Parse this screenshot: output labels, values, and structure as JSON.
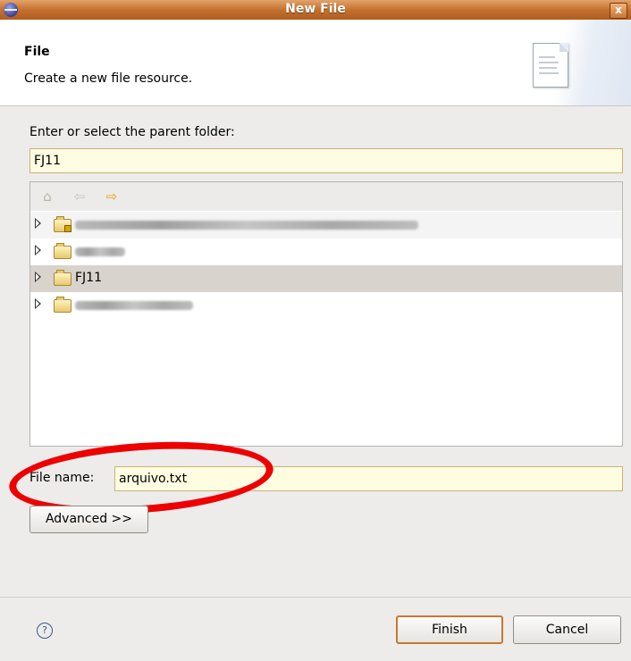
{
  "window": {
    "title": "New File",
    "close_label": "x"
  },
  "header": {
    "title": "File",
    "description": "Create a new file resource."
  },
  "parent_folder": {
    "label": "Enter or select the parent folder:",
    "value": "FJ11"
  },
  "tree": {
    "toolbar_icons": [
      "home-icon",
      "back-arrow-icon",
      "forward-arrow-icon"
    ],
    "items": [
      {
        "label": "",
        "icon": "project-folder-icon",
        "expanded": false
      },
      {
        "label": "",
        "icon": "folder-icon",
        "expanded": false
      },
      {
        "label": "FJ11",
        "icon": "folder-icon",
        "expanded": false,
        "selected": true
      },
      {
        "label": "",
        "icon": "folder-icon",
        "expanded": false
      }
    ]
  },
  "file_name": {
    "label": "File name:",
    "value": "arquivo.txt"
  },
  "advanced_button": "Advanced >>",
  "footer": {
    "finish_label": "Finish",
    "cancel_label": "Cancel"
  },
  "colors": {
    "titlebar": "#c4712f",
    "annotation_circle": "#ee0000",
    "input_background": "#fefde2"
  }
}
